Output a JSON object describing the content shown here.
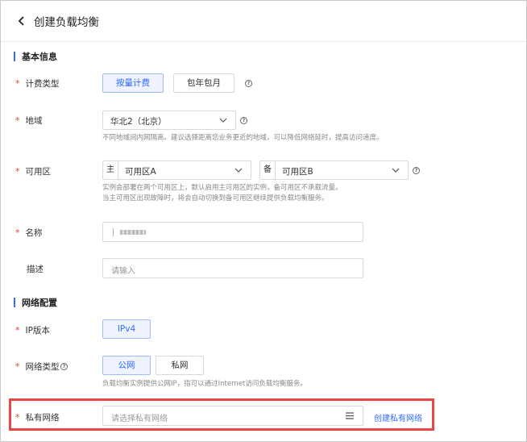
{
  "header": {
    "title": "创建负载均衡"
  },
  "sections": {
    "basic": "基本信息",
    "network": "网络配置"
  },
  "billing": {
    "label": "计费类型",
    "options": [
      "按量计费",
      "包年包月"
    ],
    "selected": "按量计费"
  },
  "region": {
    "label": "地域",
    "value": "华北2（北京）",
    "hint": "不同地域间内网隔离。建议选择距离您业务更近的地域，可以降低网络延时，提高访问速度。"
  },
  "zone": {
    "label": "可用区",
    "primary_prefix": "主",
    "primary_value": "可用区A",
    "backup_prefix": "备",
    "backup_value": "可用区B",
    "hint_line1": "实例会部署在两个可用区上，默认启用主可用区的实例，备可用区不承载流量。",
    "hint_line2": "当主可用区出现故障时，将会自动切换到备可用区继续提供负载均衡服务。"
  },
  "name": {
    "label": "名称",
    "value": ""
  },
  "description": {
    "label": "描述",
    "placeholder": "请输入"
  },
  "ip_version": {
    "label": "IP版本",
    "option": "IPv4"
  },
  "network_type": {
    "label": "网络类型",
    "options": [
      "公网",
      "私网"
    ],
    "selected": "公网",
    "hint": "负载均衡实例提供公网IP，指可以通过Internet访问负载均衡服务。"
  },
  "vpc": {
    "label": "私有网络",
    "placeholder": "请选择私有网络",
    "create_link": "创建私有网络"
  },
  "colors": {
    "accent": "#2f6bff",
    "required": "#e5412d",
    "highlight": "#e84545"
  }
}
